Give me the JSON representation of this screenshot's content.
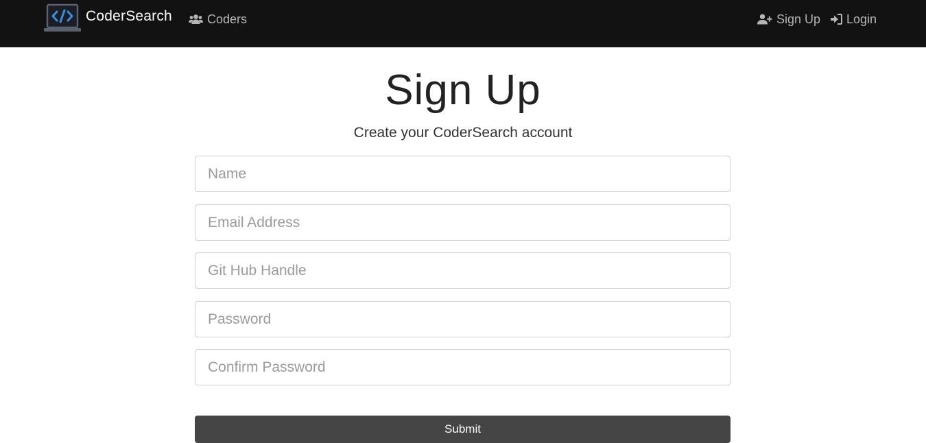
{
  "navbar": {
    "brand": "CoderSearch",
    "brand_icon": "laptop-code-icon",
    "links": {
      "coders": {
        "label": "Coders",
        "icon": "users-icon"
      },
      "signup": {
        "label": "Sign Up",
        "icon": "user-plus-icon"
      },
      "login": {
        "label": "Login",
        "icon": "sign-in-icon"
      }
    }
  },
  "page": {
    "title": "Sign Up",
    "subtitle": "Create your CoderSearch account"
  },
  "form": {
    "name": {
      "placeholder": "Name",
      "value": ""
    },
    "email": {
      "placeholder": "Email Address",
      "value": ""
    },
    "github": {
      "placeholder": "Git Hub Handle",
      "value": ""
    },
    "password": {
      "placeholder": "Password",
      "value": ""
    },
    "confirm_password": {
      "placeholder": "Confirm Password",
      "value": ""
    },
    "submit_label": "Submit"
  },
  "colors": {
    "navbar_bg": "#121212",
    "logo_accent": "#3a8fde",
    "submit_bg": "#454545"
  }
}
